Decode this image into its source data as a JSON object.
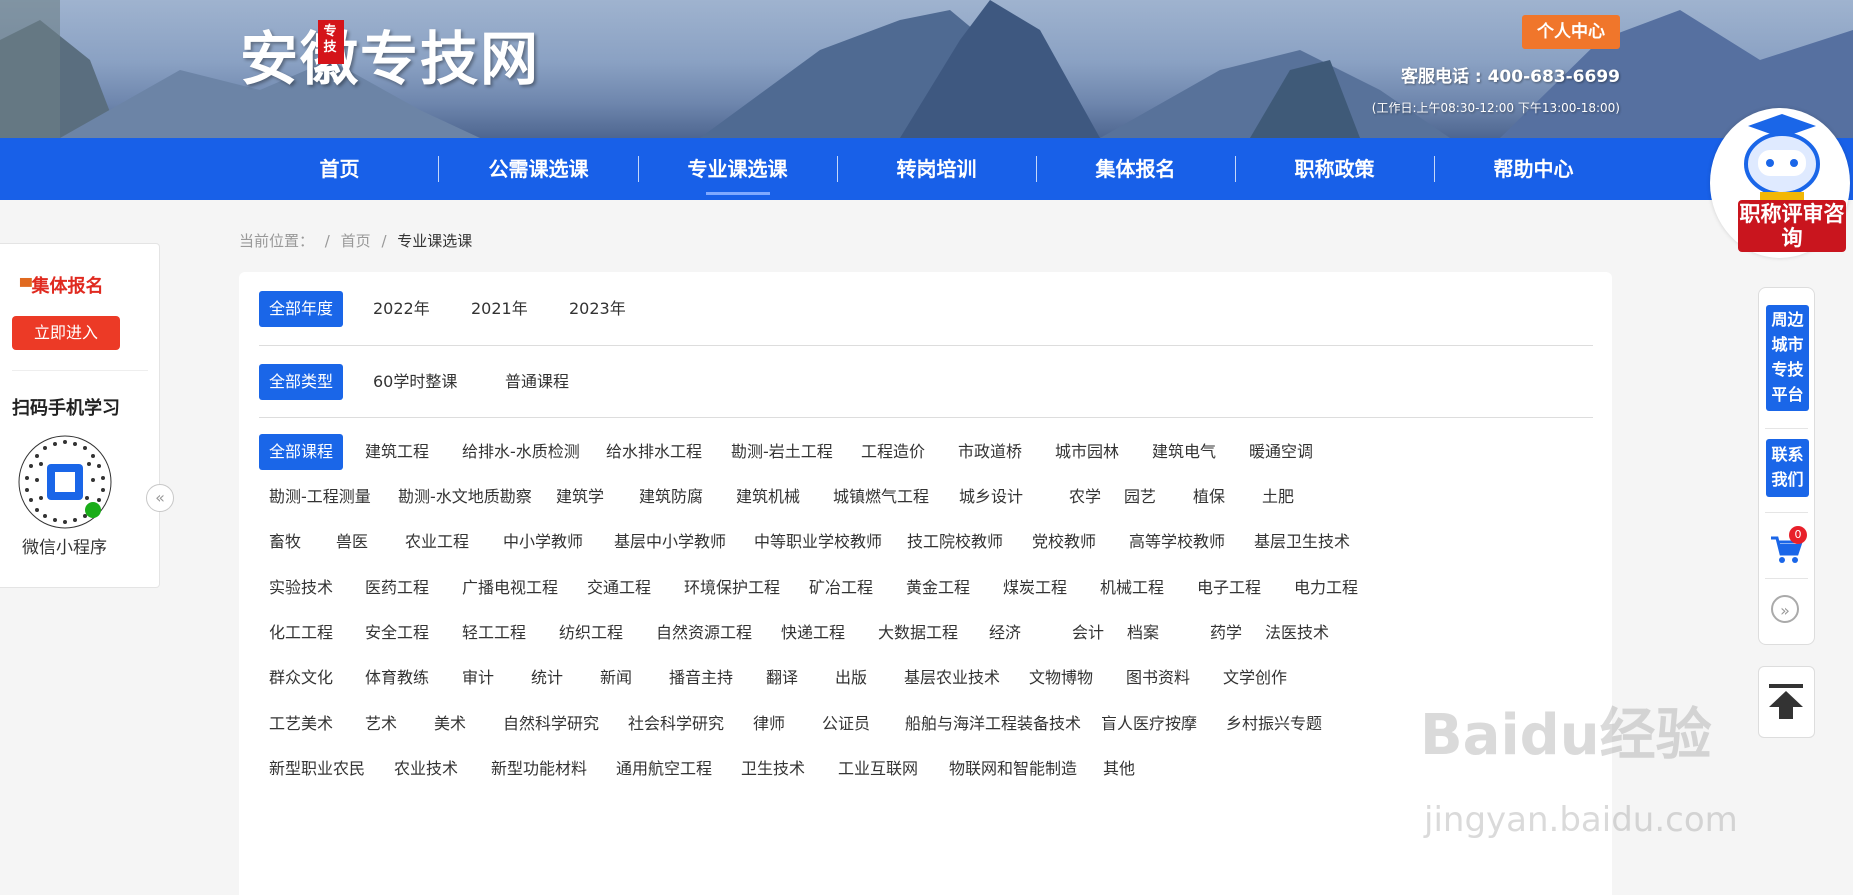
{
  "header": {
    "logo_text": "安徽专技网",
    "logo_seal": "专技",
    "personal_center": "个人中心",
    "hotline": "客服电话 : 400-683-6699",
    "hours": "(工作日:上午08:30-12:00 下午13:00-18:00)"
  },
  "nav": {
    "items": [
      "首页",
      "公需课选课",
      "专业课选课",
      "转岗培训",
      "集体报名",
      "职称政策",
      "帮助中心"
    ],
    "active_index": 2
  },
  "mascot": {
    "banner": "职称评审咨询"
  },
  "left_panel": {
    "group_title": "集体报名",
    "enter_button": "立即进入",
    "scan_title": "扫码手机学习",
    "mini_program": "微信小程序"
  },
  "breadcrumb": {
    "label": "当前位置：",
    "home": "首页",
    "current": "专业课选课"
  },
  "filters": {
    "years": [
      "全部年度",
      "2022年",
      "2021年",
      "2023年"
    ],
    "types": [
      "全部类型",
      "60学时整课",
      "普通课程"
    ],
    "categories": [
      [
        "全部课程",
        "建筑工程",
        "给排水-水质检测",
        "给水排水工程",
        "勘测-岩土工程",
        "工程造价",
        "市政道桥",
        "城市园林",
        "建筑电气",
        "暖通空调"
      ],
      [
        "勘测-工程测量",
        "勘测-水文地质勘察",
        "建筑学",
        "建筑防腐",
        "建筑机械",
        "城镇燃气工程",
        "城乡设计",
        "农学",
        "园艺",
        "植保",
        "土肥"
      ],
      [
        "畜牧",
        "兽医",
        "农业工程",
        "中小学教师",
        "基层中小学教师",
        "中等职业学校教师",
        "技工院校教师",
        "党校教师",
        "高等学校教师",
        "基层卫生技术"
      ],
      [
        "实验技术",
        "医药工程",
        "广播电视工程",
        "交通工程",
        "环境保护工程",
        "矿冶工程",
        "黄金工程",
        "煤炭工程",
        "机械工程",
        "电子工程",
        "电力工程"
      ],
      [
        "化工工程",
        "安全工程",
        "轻工工程",
        "纺织工程",
        "自然资源工程",
        "快递工程",
        "大数据工程",
        "经济",
        "会计",
        "档案",
        "药学",
        "法医技术"
      ],
      [
        "群众文化",
        "体育教练",
        "审计",
        "统计",
        "新闻",
        "播音主持",
        "翻译",
        "出版",
        "基层农业技术",
        "文物博物",
        "图书资料",
        "文学创作"
      ],
      [
        "工艺美术",
        "艺术",
        "美术",
        "自然科学研究",
        "社会科学研究",
        "律师",
        "公证员",
        "船舶与海洋工程装备技术",
        "盲人医疗按摩",
        "乡村振兴专题"
      ],
      [
        "新型职业农民",
        "农业技术",
        "新型功能材料",
        "通用航空工程",
        "卫生技术",
        "工业互联网",
        "物联网和智能制造",
        "其他"
      ]
    ]
  },
  "right_bar": {
    "nearby": "周边城市专技平台",
    "contact": "联系我们",
    "cart_count": "0"
  },
  "watermark": {
    "brand": "Baidu经验",
    "url": "jingyan.baidu.com"
  }
}
